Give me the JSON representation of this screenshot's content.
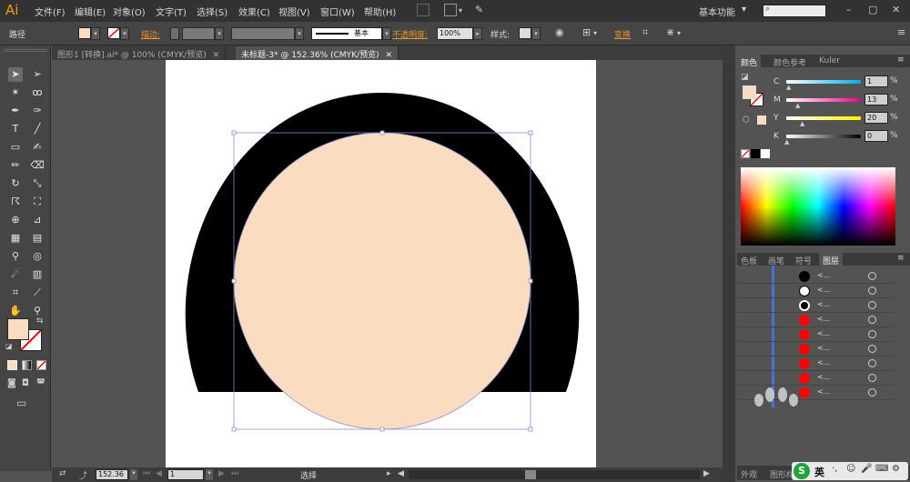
{
  "app": {
    "logo": "Ai"
  },
  "menu": {
    "items": [
      "文件(F)",
      "编辑(E)",
      "对象(O)",
      "文字(T)",
      "选择(S)",
      "效果(C)",
      "视图(V)",
      "窗口(W)",
      "帮助(H)"
    ],
    "workspace": "基本功能",
    "workspace_arrow": "▾"
  },
  "control_bar": {
    "selection_type": "路径",
    "stroke_label": "描边:",
    "stroke_style": "基本",
    "opacity_label": "不透明度:",
    "opacity_value": "100%",
    "style_label": "样式:",
    "transform_label": "变换"
  },
  "tabs": [
    {
      "label": "图形1 [转换].ai* @ 100% (CMYK/预览)",
      "close": "✕"
    },
    {
      "label": "未标题-3* @ 152.36% (CMYK/预览)",
      "close": "✕"
    }
  ],
  "colors": {
    "fill": "#FADCC0",
    "arch": "#000000",
    "selection": "#8a8fd0",
    "accent": "#ff9a00"
  },
  "color_panel": {
    "tabs": [
      "颜色",
      "颜色参考",
      "Kuler"
    ],
    "channels": [
      {
        "label": "C",
        "value": "1",
        "track": "linear-gradient(90deg,#fff,#00aeef)"
      },
      {
        "label": "M",
        "value": "13",
        "track": "linear-gradient(90deg,#fff,#ec008c)"
      },
      {
        "label": "Y",
        "value": "20",
        "track": "linear-gradient(90deg,#fff,#fff200)"
      },
      {
        "label": "K",
        "value": "0",
        "track": "linear-gradient(90deg,#fff,#000)"
      }
    ]
  },
  "layers_panel": {
    "tabs": [
      "色板",
      "画笔",
      "符号",
      "图层"
    ],
    "rows": [
      {
        "thumb": "#000000",
        "name": "<..."
      },
      {
        "thumb": "#ffffff",
        "name": "<..."
      },
      {
        "thumb": "#000000",
        "name": "<..."
      },
      {
        "thumb": "#ff0000",
        "name": "<..."
      },
      {
        "thumb": "#ff0000",
        "name": "<..."
      },
      {
        "thumb": "#ff0000",
        "name": "<..."
      },
      {
        "thumb": "#ff0000",
        "name": "<..."
      },
      {
        "thumb": "#ff0000",
        "name": "<..."
      },
      {
        "thumb": "#ff0000",
        "name": "<..."
      }
    ]
  },
  "bottom_tabs": [
    "外观",
    "图形样"
  ],
  "status": {
    "zoom": "152.36",
    "artboard": "1",
    "tool": "选择"
  },
  "ime": {
    "label": "英"
  }
}
